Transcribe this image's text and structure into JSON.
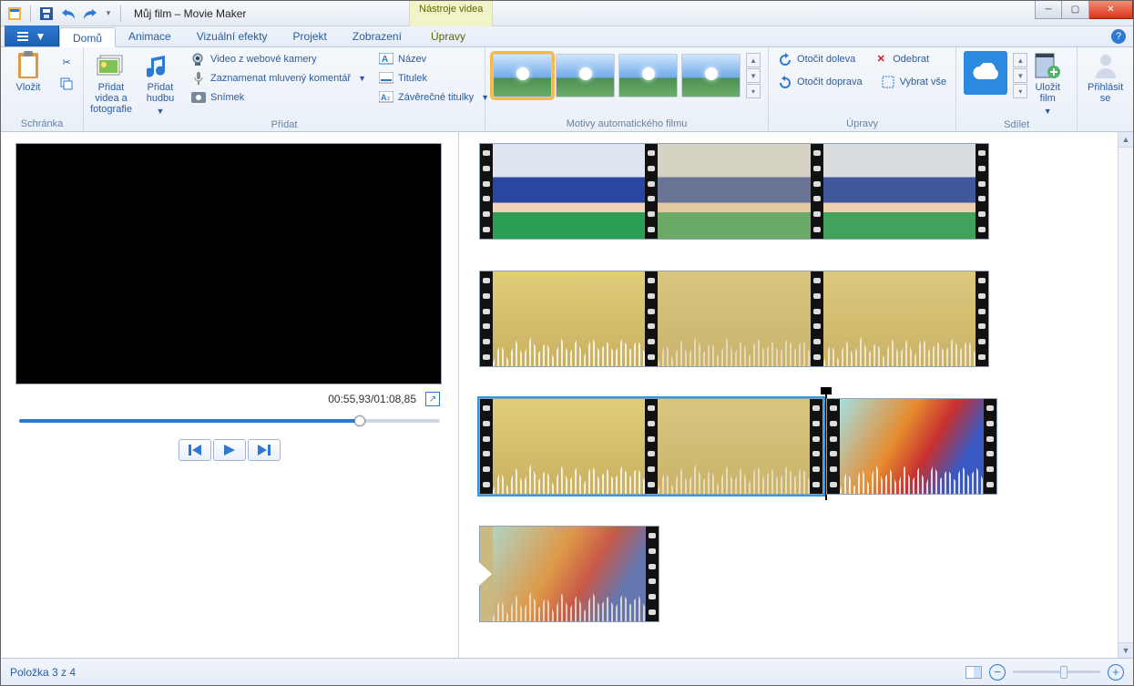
{
  "titlebar": {
    "title": "Můj film – Movie Maker",
    "tools_tab": "Nástroje videa"
  },
  "tabs": {
    "home": "Domů",
    "anim": "Animace",
    "fx": "Vizuální efekty",
    "project": "Projekt",
    "view": "Zobrazení",
    "edits": "Úpravy"
  },
  "groups": {
    "clipboard": "Schránka",
    "add": "Přidat",
    "themes": "Motivy automatického filmu",
    "editing": "Úpravy",
    "share": "Sdílet"
  },
  "btn": {
    "paste": "Vložit",
    "add_media": "Přidat videa a fotografie",
    "add_music": "Přidat hudbu",
    "webcam": "Video z webové kamery",
    "narration": "Zaznamenat mluvený komentář",
    "snapshot": "Snímek",
    "title": "Název",
    "caption": "Titulek",
    "credits": "Závěrečné titulky",
    "rotate_left": "Otočit doleva",
    "rotate_right": "Otočit doprava",
    "remove": "Odebrat",
    "select_all": "Vybrat vše",
    "save_movie": "Uložit film",
    "sign_in": "Přihlásit se"
  },
  "preview": {
    "time": "00:55,93/01:08,85"
  },
  "status": {
    "item": "Položka 3 z 4"
  }
}
